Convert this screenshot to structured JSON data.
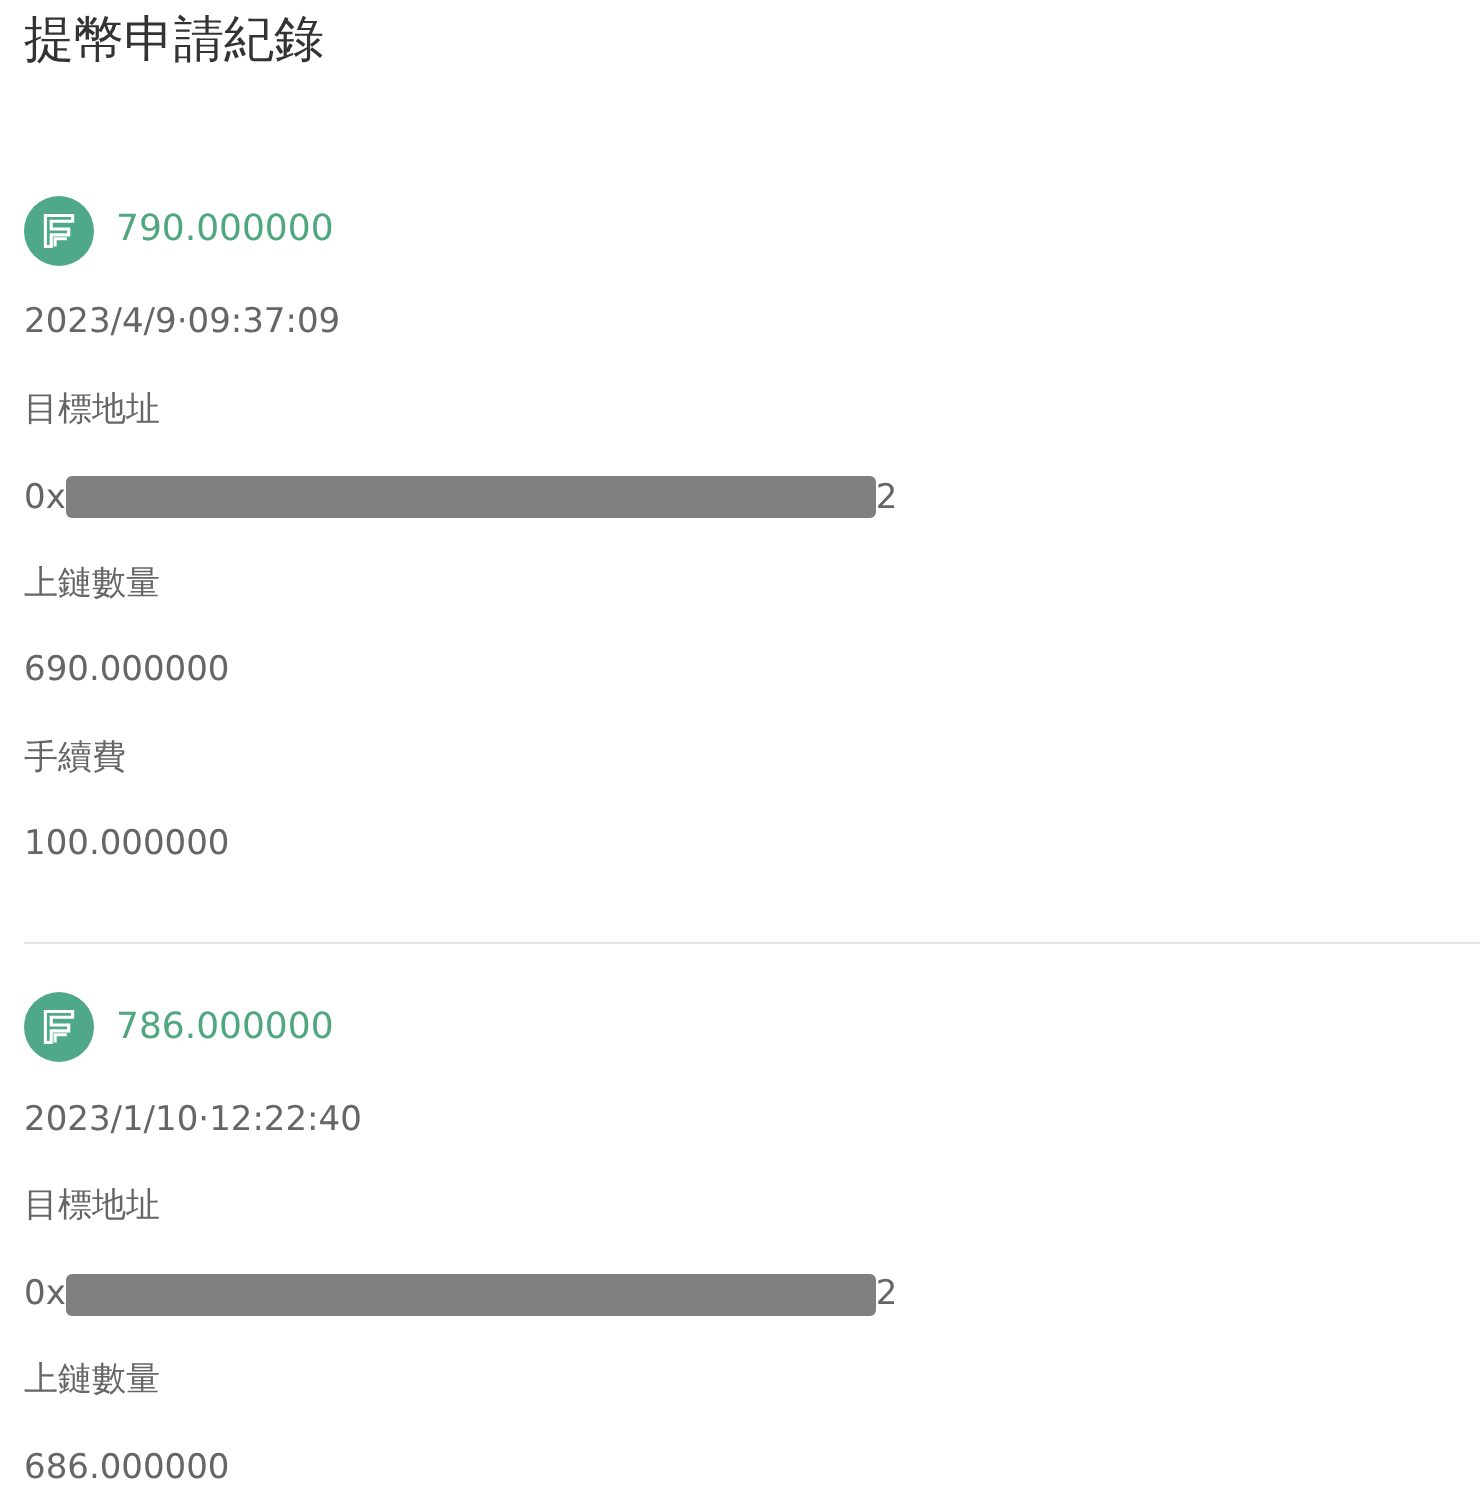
{
  "title": "提幣申請紀錄",
  "records": [
    {
      "amount": "790.000000",
      "time": "2023/4/9·09:37:09",
      "fields": [
        {
          "kind": "address",
          "label": "目標地址",
          "value_start": "0x",
          "value_end": "2"
        },
        {
          "kind": "text",
          "label": "上鏈數量",
          "value": "690.000000"
        },
        {
          "kind": "text",
          "label": "手續費",
          "value": "100.000000"
        }
      ]
    },
    {
      "amount": "786.000000",
      "time": "2023/1/10·12:22:40",
      "fields": [
        {
          "kind": "address",
          "label": "目標地址",
          "value_start": "0x",
          "value_end": "2"
        },
        {
          "kind": "text",
          "label": "上鏈數量",
          "value": "686.000000"
        }
      ]
    }
  ]
}
